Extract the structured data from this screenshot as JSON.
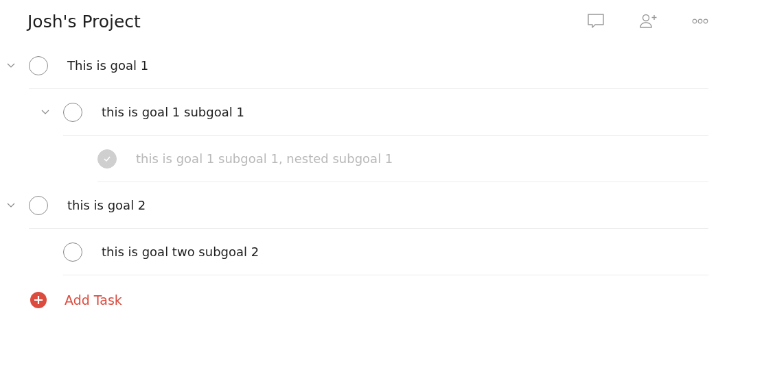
{
  "project": {
    "title": "Josh's Project"
  },
  "tasks": [
    {
      "label": "This is goal 1",
      "checked": false,
      "expanded": true,
      "children": [
        {
          "label": "this is goal 1 subgoal 1",
          "checked": false,
          "expanded": true,
          "children": [
            {
              "label": "this is goal 1 subgoal 1, nested subgoal 1",
              "checked": true
            }
          ]
        }
      ]
    },
    {
      "label": "this is goal 2",
      "checked": false,
      "expanded": true,
      "children": [
        {
          "label": "this is goal two subgoal 2",
          "checked": false
        }
      ]
    }
  ],
  "add_task": {
    "label": "Add Task"
  }
}
